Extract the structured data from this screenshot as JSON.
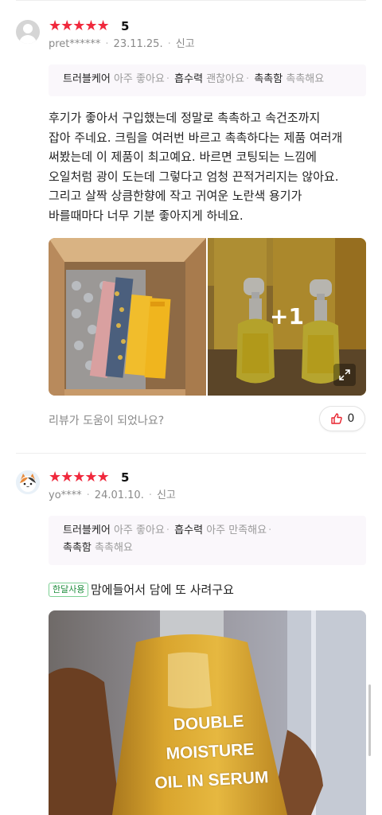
{
  "colors": {
    "star": "#f0283c",
    "accent_red": "#e8232f",
    "badge_green": "#1f8c3d"
  },
  "reviews": [
    {
      "avatar": "default-user-avatar",
      "stars": "★★★★★",
      "score": "5",
      "user": "pret******",
      "date": "23.11.25.",
      "report": "신고",
      "attributes": [
        {
          "key": "트러블케어",
          "value": "아주 좋아요"
        },
        {
          "key": "흡수력",
          "value": "괜찮아요"
        },
        {
          "key": "촉촉함",
          "value": "촉촉해요"
        }
      ],
      "text_lines": [
        "후기가 좋아서 구입했는데 정말로 촉촉하고 속건조까지",
        "잡아 주네요. 크림을 여러번 바르고 촉촉하다는 제품 여러개",
        "써봤는데 이 제품이 최고예요. 바르면 코팅되는 느낌에",
        "오일처럼 광이 도는데 그렇다고 엄청 끈적거리지는 않아요.",
        "그리고 살짝 상큼한향에 작고 귀여운 노란색 용기가",
        "바를때마다 너무 기분 좋아지게 하네요."
      ],
      "more_photos": "+1",
      "helpful_question": "리뷰가 도움이 되었나요?",
      "helpful_count": "0"
    },
    {
      "avatar": "cat-avatar",
      "stars": "★★★★★",
      "score": "5",
      "user": "yo****",
      "date": "24.01.10.",
      "report": "신고",
      "attributes": [
        {
          "key": "트러블케어",
          "value": "아주 좋아요"
        },
        {
          "key": "흡수력",
          "value": "아주 만족해요"
        },
        {
          "key": "촉촉함",
          "value": "촉촉해요"
        }
      ],
      "badge": "한달사용",
      "text": "맘에들어서 담에 또 사려구요",
      "photo_text": [
        "DOUBLE",
        "MOISTURE",
        "OIL IN SERUM"
      ]
    }
  ]
}
